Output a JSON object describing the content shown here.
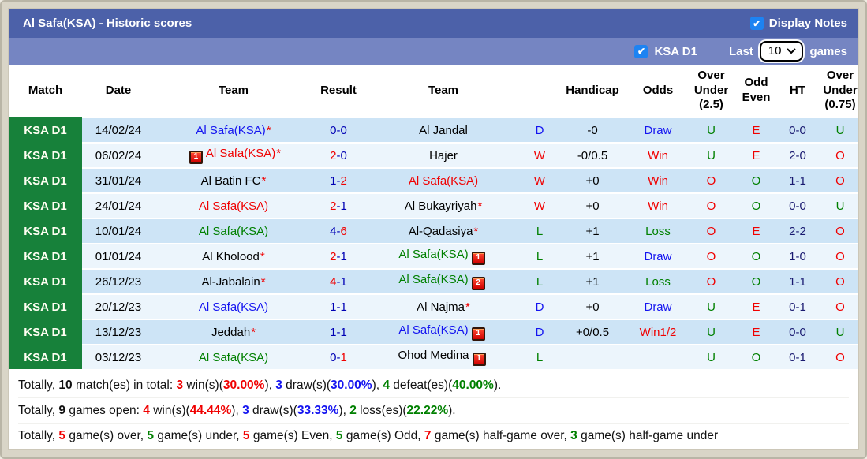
{
  "titlebar": {
    "title": "Al Safa(KSA) - Historic scores",
    "display_notes_label": "Display Notes"
  },
  "filterbar": {
    "league_label": "KSA D1",
    "last_label": "Last",
    "selected_count": "10",
    "games_label": "games"
  },
  "colors": {
    "accent_header": "#4c61a9",
    "accent_subheader": "#7585c2",
    "league_green": "#17813a",
    "row_blue": "#cde4f6",
    "row_light": "#ecf5fc",
    "win_red": "#f00000",
    "loss_green": "#008000",
    "draw_blue": "#1414f0",
    "score_navy": "#0000b4",
    "ht_navy": "#191970",
    "checkbox_blue": "#1d83f2"
  },
  "table": {
    "headers": {
      "match": "Match",
      "date": "Date",
      "team_home": "Team",
      "result": "Result",
      "team_away": "Team",
      "wdl": "",
      "handicap": "Handicap",
      "odds": "Odds",
      "over_under_25": "Over\nUnder\n(2.5)",
      "odd_even": "Odd\nEven",
      "ht": "HT",
      "over_under_075": "Over\nUnder\n(0.75)"
    },
    "rows": [
      {
        "league": "KSA D1",
        "date": "14/02/24",
        "home": {
          "name": "Al Safa(KSA)",
          "star": true,
          "color": "blue"
        },
        "result": {
          "h": "0",
          "a": "0",
          "winner": "none"
        },
        "away": {
          "name": "Al Jandal",
          "star": false,
          "color": "black"
        },
        "wdl": {
          "text": "D",
          "color": "blue"
        },
        "handicap": "-0",
        "odds": {
          "text": "Draw",
          "color": "blue"
        },
        "over_under_25": {
          "text": "U",
          "color": "green"
        },
        "odd_even": {
          "text": "E",
          "color": "red"
        },
        "ht": "0-0",
        "over_under_075": {
          "text": "U",
          "color": "green"
        }
      },
      {
        "league": "KSA D1",
        "date": "06/02/24",
        "home": {
          "name": "Al Safa(KSA)",
          "star": true,
          "color": "red",
          "icon": "1"
        },
        "result": {
          "h": "2",
          "a": "0",
          "winner": "home"
        },
        "away": {
          "name": "Hajer",
          "star": false,
          "color": "black"
        },
        "wdl": {
          "text": "W",
          "color": "red"
        },
        "handicap": "-0/0.5",
        "odds": {
          "text": "Win",
          "color": "red"
        },
        "over_under_25": {
          "text": "U",
          "color": "green"
        },
        "odd_even": {
          "text": "E",
          "color": "red"
        },
        "ht": "2-0",
        "over_under_075": {
          "text": "O",
          "color": "red"
        }
      },
      {
        "league": "KSA D1",
        "date": "31/01/24",
        "home": {
          "name": "Al Batin FC",
          "star": true,
          "color": "black"
        },
        "result": {
          "h": "1",
          "a": "2",
          "winner": "away"
        },
        "away": {
          "name": "Al Safa(KSA)",
          "star": false,
          "color": "red"
        },
        "wdl": {
          "text": "W",
          "color": "red"
        },
        "handicap": "+0",
        "odds": {
          "text": "Win",
          "color": "red"
        },
        "over_under_25": {
          "text": "O",
          "color": "red"
        },
        "odd_even": {
          "text": "O",
          "color": "green"
        },
        "ht": "1-1",
        "over_under_075": {
          "text": "O",
          "color": "red"
        }
      },
      {
        "league": "KSA D1",
        "date": "24/01/24",
        "home": {
          "name": "Al Safa(KSA)",
          "star": false,
          "color": "red"
        },
        "result": {
          "h": "2",
          "a": "1",
          "winner": "home"
        },
        "away": {
          "name": "Al Bukayriyah",
          "star": true,
          "color": "black"
        },
        "wdl": {
          "text": "W",
          "color": "red"
        },
        "handicap": "+0",
        "odds": {
          "text": "Win",
          "color": "red"
        },
        "over_under_25": {
          "text": "O",
          "color": "red"
        },
        "odd_even": {
          "text": "O",
          "color": "green"
        },
        "ht": "0-0",
        "over_under_075": {
          "text": "U",
          "color": "green"
        }
      },
      {
        "league": "KSA D1",
        "date": "10/01/24",
        "home": {
          "name": "Al Safa(KSA)",
          "star": false,
          "color": "green"
        },
        "result": {
          "h": "4",
          "a": "6",
          "winner": "away"
        },
        "away": {
          "name": "Al-Qadasiya",
          "star": true,
          "color": "black"
        },
        "wdl": {
          "text": "L",
          "color": "green"
        },
        "handicap": "+1",
        "odds": {
          "text": "Loss",
          "color": "green"
        },
        "over_under_25": {
          "text": "O",
          "color": "red"
        },
        "odd_even": {
          "text": "E",
          "color": "red"
        },
        "ht": "2-2",
        "over_under_075": {
          "text": "O",
          "color": "red"
        }
      },
      {
        "league": "KSA D1",
        "date": "01/01/24",
        "home": {
          "name": "Al Kholood",
          "star": true,
          "color": "black"
        },
        "result": {
          "h": "2",
          "a": "1",
          "winner": "home"
        },
        "away": {
          "name": "Al Safa(KSA)",
          "star": false,
          "color": "green",
          "icon": "1"
        },
        "wdl": {
          "text": "L",
          "color": "green"
        },
        "handicap": "+1",
        "odds": {
          "text": "Draw",
          "color": "blue"
        },
        "over_under_25": {
          "text": "O",
          "color": "red"
        },
        "odd_even": {
          "text": "O",
          "color": "green"
        },
        "ht": "1-0",
        "over_under_075": {
          "text": "O",
          "color": "red"
        }
      },
      {
        "league": "KSA D1",
        "date": "26/12/23",
        "home": {
          "name": "Al-Jabalain",
          "star": true,
          "color": "black"
        },
        "result": {
          "h": "4",
          "a": "1",
          "winner": "home"
        },
        "away": {
          "name": "Al Safa(KSA)",
          "star": false,
          "color": "green",
          "icon": "2"
        },
        "wdl": {
          "text": "L",
          "color": "green"
        },
        "handicap": "+1",
        "odds": {
          "text": "Loss",
          "color": "green"
        },
        "over_under_25": {
          "text": "O",
          "color": "red"
        },
        "odd_even": {
          "text": "O",
          "color": "green"
        },
        "ht": "1-1",
        "over_under_075": {
          "text": "O",
          "color": "red"
        }
      },
      {
        "league": "KSA D1",
        "date": "20/12/23",
        "home": {
          "name": "Al Safa(KSA)",
          "star": false,
          "color": "blue"
        },
        "result": {
          "h": "1",
          "a": "1",
          "winner": "none"
        },
        "away": {
          "name": "Al Najma",
          "star": true,
          "color": "black"
        },
        "wdl": {
          "text": "D",
          "color": "blue"
        },
        "handicap": "+0",
        "odds": {
          "text": "Draw",
          "color": "blue"
        },
        "over_under_25": {
          "text": "U",
          "color": "green"
        },
        "odd_even": {
          "text": "E",
          "color": "red"
        },
        "ht": "0-1",
        "over_under_075": {
          "text": "O",
          "color": "red"
        }
      },
      {
        "league": "KSA D1",
        "date": "13/12/23",
        "home": {
          "name": "Jeddah",
          "star": true,
          "color": "black"
        },
        "result": {
          "h": "1",
          "a": "1",
          "winner": "none"
        },
        "away": {
          "name": "Al Safa(KSA)",
          "star": false,
          "color": "blue",
          "icon": "1"
        },
        "wdl": {
          "text": "D",
          "color": "blue"
        },
        "handicap": "+0/0.5",
        "odds": {
          "text": "Win1/2",
          "color": "red"
        },
        "over_under_25": {
          "text": "U",
          "color": "green"
        },
        "odd_even": {
          "text": "E",
          "color": "red"
        },
        "ht": "0-0",
        "over_under_075": {
          "text": "U",
          "color": "green"
        }
      },
      {
        "league": "KSA D1",
        "date": "03/12/23",
        "home": {
          "name": "Al Safa(KSA)",
          "star": false,
          "color": "green"
        },
        "result": {
          "h": "0",
          "a": "1",
          "winner": "away"
        },
        "away": {
          "name": "Ohod Medina",
          "star": false,
          "color": "black",
          "icon": "1"
        },
        "wdl": {
          "text": "L",
          "color": "green"
        },
        "handicap": "",
        "odds": {
          "text": "",
          "color": "black"
        },
        "over_under_25": {
          "text": "U",
          "color": "green"
        },
        "odd_even": {
          "text": "O",
          "color": "green"
        },
        "ht": "0-1",
        "over_under_075": {
          "text": "O",
          "color": "red"
        }
      }
    ]
  },
  "footer": {
    "lines": [
      [
        {
          "t": "Totally, ",
          "s": "n"
        },
        {
          "t": "10",
          "s": "b"
        },
        {
          "t": " match(es) in total: ",
          "s": "n"
        },
        {
          "t": "3",
          "s": "r"
        },
        {
          "t": " win(s)(",
          "s": "n"
        },
        {
          "t": "30.00%",
          "s": "r"
        },
        {
          "t": "), ",
          "s": "n"
        },
        {
          "t": "3",
          "s": "bl"
        },
        {
          "t": " draw(s)(",
          "s": "n"
        },
        {
          "t": "30.00%",
          "s": "bl"
        },
        {
          "t": "), ",
          "s": "n"
        },
        {
          "t": "4",
          "s": "g"
        },
        {
          "t": " defeat(es)(",
          "s": "n"
        },
        {
          "t": "40.00%",
          "s": "g"
        },
        {
          "t": ").",
          "s": "n"
        }
      ],
      [
        {
          "t": "Totally, ",
          "s": "n"
        },
        {
          "t": "9",
          "s": "b"
        },
        {
          "t": " games open: ",
          "s": "n"
        },
        {
          "t": "4",
          "s": "r"
        },
        {
          "t": " win(s)(",
          "s": "n"
        },
        {
          "t": "44.44%",
          "s": "r"
        },
        {
          "t": "), ",
          "s": "n"
        },
        {
          "t": "3",
          "s": "bl"
        },
        {
          "t": " draw(s)(",
          "s": "n"
        },
        {
          "t": "33.33%",
          "s": "bl"
        },
        {
          "t": "), ",
          "s": "n"
        },
        {
          "t": "2",
          "s": "g"
        },
        {
          "t": " loss(es)(",
          "s": "n"
        },
        {
          "t": "22.22%",
          "s": "g"
        },
        {
          "t": ").",
          "s": "n"
        }
      ],
      [
        {
          "t": "Totally, ",
          "s": "n"
        },
        {
          "t": "5",
          "s": "r"
        },
        {
          "t": " game(s) over, ",
          "s": "n"
        },
        {
          "t": "5",
          "s": "g"
        },
        {
          "t": " game(s) under, ",
          "s": "n"
        },
        {
          "t": "5",
          "s": "r"
        },
        {
          "t": " game(s) Even, ",
          "s": "n"
        },
        {
          "t": "5",
          "s": "g"
        },
        {
          "t": " game(s) Odd, ",
          "s": "n"
        },
        {
          "t": "7",
          "s": "r"
        },
        {
          "t": " game(s) half-game over, ",
          "s": "n"
        },
        {
          "t": "3",
          "s": "g"
        },
        {
          "t": " game(s) half-game under",
          "s": "n"
        }
      ]
    ]
  }
}
